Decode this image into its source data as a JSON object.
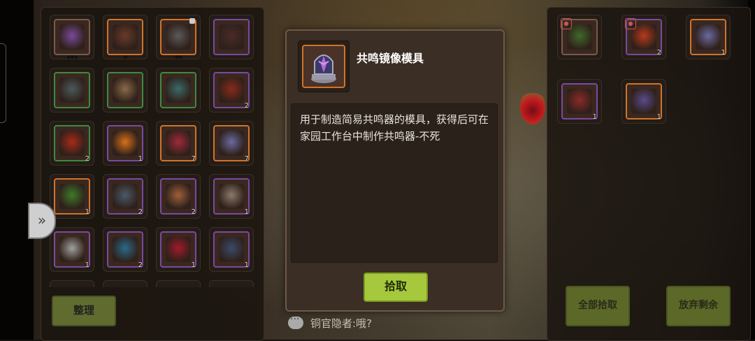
{
  "left_inventory": {
    "sort_label": "整理",
    "slots": [
      {
        "icon": "purple-flower-icon",
        "qty": "",
        "border": "#7a5a4a",
        "art": "#7a4a9a",
        "dots": "◆◆◆",
        "lock": false
      },
      {
        "icon": "bow-icon",
        "qty": "",
        "border": "#d0742a",
        "art": "#6a3a2a",
        "dots": "◆",
        "lock": false
      },
      {
        "icon": "staff-icon",
        "qty": "",
        "border": "#d0742a",
        "art": "#5a5a5a",
        "dots": "◆◆",
        "lock": true
      },
      {
        "icon": "bow-icon",
        "qty": "",
        "border": "#7a4aa0",
        "art": "#4a2a2a",
        "dots": "",
        "lock": false
      },
      {
        "icon": "spear-icon",
        "qty": "",
        "border": "#3f8a3f",
        "art": "#4a5a5a",
        "dots": "",
        "lock": false
      },
      {
        "icon": "armor-icon",
        "qty": "",
        "border": "#3f8a3f",
        "art": "#8a6a4a",
        "dots": "",
        "lock": false
      },
      {
        "icon": "robe-icon",
        "qty": "",
        "border": "#3f8a3f",
        "art": "#3a6a6a",
        "dots": "",
        "lock": false
      },
      {
        "icon": "claw-icon",
        "qty": "2",
        "border": "#7a4aa0",
        "art": "#8a2a1a",
        "dots": "",
        "lock": false
      },
      {
        "icon": "axe-icon",
        "qty": "2",
        "border": "#3f8a3f",
        "art": "#a82a1a",
        "dots": "",
        "lock": false
      },
      {
        "icon": "sun-orb-icon",
        "qty": "1",
        "border": "#7a4aa0",
        "art": "#d8701a",
        "dots": "",
        "lock": false
      },
      {
        "icon": "potion-icon",
        "qty": "7",
        "border": "#d0742a",
        "art": "#a02a3a",
        "dots": "",
        "lock": false
      },
      {
        "icon": "crystal-icon",
        "qty": "7",
        "border": "#d0742a",
        "art": "#6a6aa0",
        "dots": "",
        "lock": false
      },
      {
        "icon": "herb-icon",
        "qty": "1",
        "border": "#d0742a",
        "art": "#3f7a2a",
        "dots": "",
        "lock": false
      },
      {
        "icon": "ore-icon",
        "qty": "2",
        "border": "#7a4aa0",
        "art": "#4a5a6a",
        "dots": "",
        "lock": false
      },
      {
        "icon": "meat-icon",
        "qty": "2",
        "border": "#7a4aa0",
        "art": "#a0603a",
        "dots": "",
        "lock": false
      },
      {
        "icon": "scroll-icon",
        "qty": "1",
        "border": "#7a4aa0",
        "art": "#8a7a6a",
        "dots": "",
        "lock": false
      },
      {
        "icon": "egg-icon",
        "qty": "1",
        "border": "#7a4aa0",
        "art": "#a0a0a0",
        "dots": "",
        "lock": false
      },
      {
        "icon": "blue-gem-icon",
        "qty": "2",
        "border": "#7a4aa0",
        "art": "#2a6a8a",
        "dots": "",
        "lock": false
      },
      {
        "icon": "red-crystal-icon",
        "qty": "1",
        "border": "#7a4aa0",
        "art": "#a01a2a",
        "dots": "",
        "lock": false
      },
      {
        "icon": "dark-gem-icon",
        "qty": "1",
        "border": "#7a4aa0",
        "art": "#3a4a6a",
        "dots": "",
        "lock": false
      }
    ]
  },
  "right_loot": {
    "slots": [
      {
        "icon": "green-bow-icon",
        "qty": "",
        "border": "#7a5a4a",
        "art": "#3f6a2a",
        "new": true
      },
      {
        "icon": "red-claw-icon",
        "qty": "2",
        "border": "#7a4aa0",
        "art": "#b83a1a",
        "new": true
      },
      {
        "icon": "crystal-icon",
        "qty": "1",
        "border": "#d0742a",
        "art": "#6a6aa0",
        "new": false
      },
      {
        "icon": "red-horn-icon",
        "qty": "1",
        "border": "#7a4aa0",
        "art": "#8a2a2a",
        "new": false
      },
      {
        "icon": "mirror-mold-icon",
        "qty": "1",
        "border": "#d0742a",
        "art": "#5a4a8a",
        "new": false
      }
    ],
    "pick_all_label": "全部拾取",
    "discard_label": "放弃剩余"
  },
  "item_detail": {
    "name": "共鸣镜像模具",
    "icon": "mirror-mold-icon",
    "description": "用于制造简易共鸣器的模具，获得后可在家园工作台中制作共鸣器-不死",
    "pick_label": "拾取"
  },
  "chat": {
    "message": "铜官隐者:哦?"
  },
  "colors": {
    "pick_button": "#a6c83c",
    "legendary_border": "#d0742a",
    "epic_border": "#7a4aa0",
    "uncommon_border": "#3f8a3f"
  }
}
